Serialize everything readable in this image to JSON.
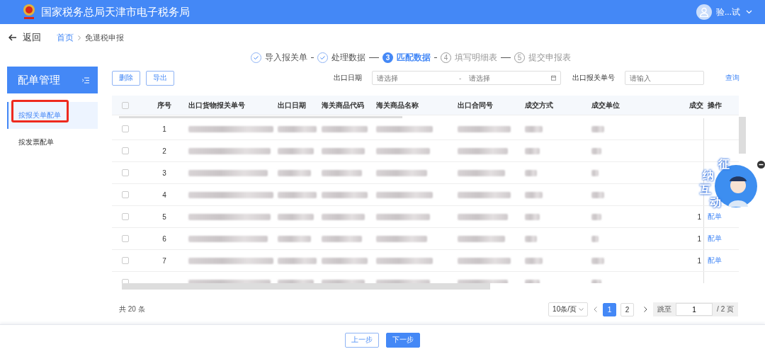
{
  "header": {
    "title": "国家税务总局天津市电子税务局",
    "user": "验...试"
  },
  "nav": {
    "back": "返回",
    "breadcrumb": [
      {
        "label": "首页",
        "link": true
      },
      {
        "label": "免退税申报",
        "link": false
      }
    ]
  },
  "steps": [
    {
      "label": "导入报关单",
      "done": true,
      "selected": false
    },
    {
      "label": "处理数据",
      "done": true,
      "selected": false
    },
    {
      "num": "3",
      "label": "匹配数据",
      "done": false,
      "selected": true
    },
    {
      "num": "4",
      "label": "填写明细表",
      "done": false,
      "selected": false
    },
    {
      "num": "5",
      "label": "提交申报表",
      "done": false,
      "selected": false
    }
  ],
  "sidebar": {
    "title": "配单管理",
    "items": [
      {
        "label": "按报关单配单",
        "selected": true,
        "highlighted": true
      },
      {
        "label": "按发票配单",
        "selected": false,
        "highlighted": false
      }
    ]
  },
  "toolbar": {
    "buttons": [
      "删除",
      "导出"
    ],
    "date_label": "出口日期",
    "date_start": {
      "placeholder": "请选择"
    },
    "date_sep": "-",
    "date_end": {
      "placeholder": "请选择"
    },
    "number_label": "出口报关单号",
    "number_field": {
      "placeholder": "请输入"
    },
    "query": "查询"
  },
  "table": {
    "all_checked": false,
    "columns": [
      "序号",
      "出口货物报关单号",
      "出口日期",
      "海关商品代码",
      "海关商品名称",
      "出口合同号",
      "成交方式",
      "成交单位",
      "成交",
      "操作"
    ],
    "rows": [
      {
        "index": "1",
        "checked": false
      },
      {
        "index": "2",
        "checked": false
      },
      {
        "index": "3",
        "checked": false
      },
      {
        "index": "4",
        "checked": false
      },
      {
        "index": "5",
        "checked": false,
        "qty": "1",
        "action": "配单"
      },
      {
        "index": "6",
        "checked": false,
        "qty": "1",
        "action": "配单"
      },
      {
        "index": "7",
        "checked": false,
        "qty": "1",
        "action": "配单"
      },
      {
        "checked": false
      }
    ]
  },
  "footer": {
    "total": "共 20 条",
    "page_size": "10条/页",
    "pages": [
      {
        "label": "1",
        "selected": true
      },
      {
        "label": "2",
        "selected": false
      }
    ],
    "jump_label": "跳至",
    "jump_value": "1",
    "page_total": "/ 2 页"
  },
  "widget": {
    "chars": [
      "征",
      "纳",
      "互",
      "动"
    ]
  },
  "actions": {
    "prev": "上一步",
    "next": "下一步"
  }
}
